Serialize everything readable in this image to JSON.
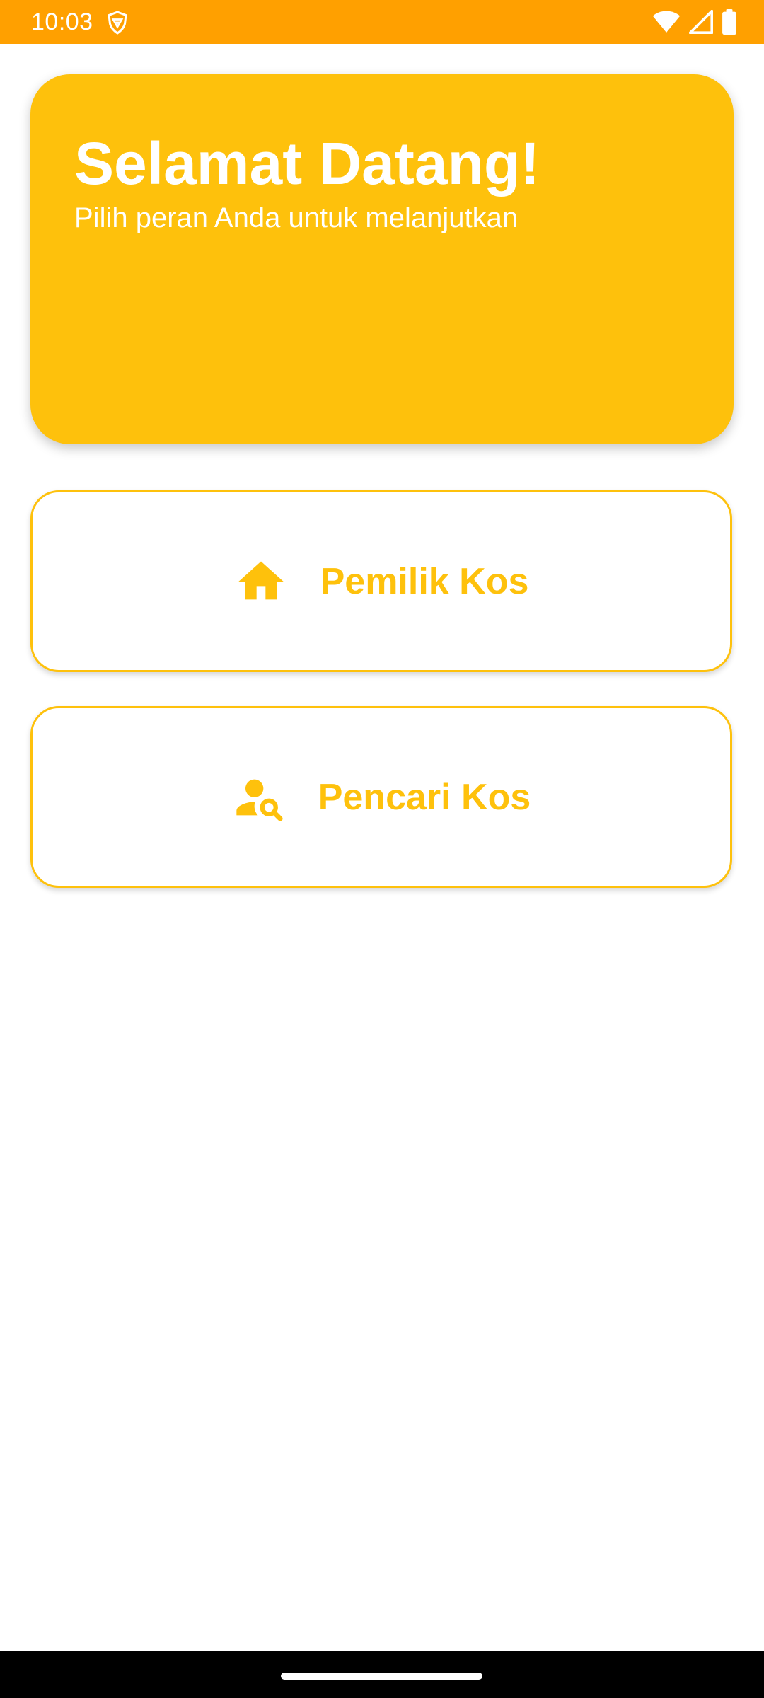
{
  "status_bar": {
    "time": "10:03",
    "background_color": "#ffa000",
    "icons": [
      "shield-icon",
      "wifi-icon",
      "signal-icon",
      "battery-icon"
    ]
  },
  "header": {
    "title": "Selamat Datang!",
    "subtitle": "Pilih peran Anda untuk melanjutkan",
    "background_color": "#fec10c"
  },
  "roles": [
    {
      "label": "Pemilik Kos",
      "icon": "home-icon"
    },
    {
      "label": "Pencari Kos",
      "icon": "person-search-icon"
    }
  ],
  "colors": {
    "accent": "#fec10c",
    "status_bar": "#ffa000",
    "background": "#ffffff"
  }
}
